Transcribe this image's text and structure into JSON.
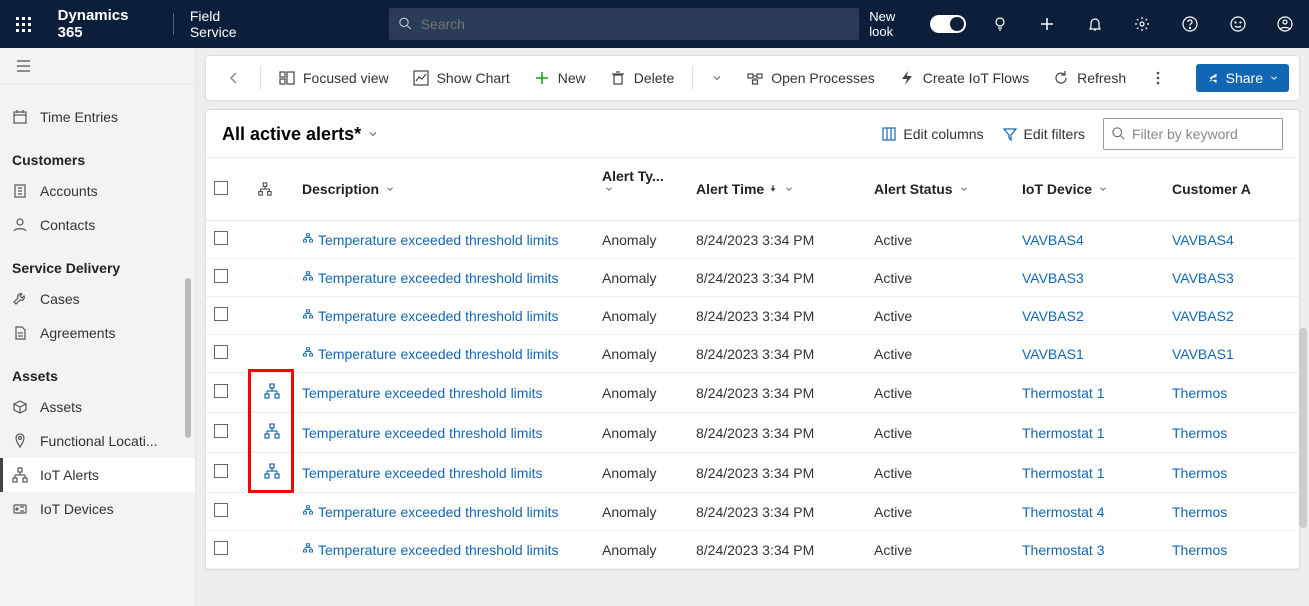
{
  "nav": {
    "brand": "Dynamics 365",
    "area": "Field Service",
    "search_placeholder": "Search",
    "newlook": "New look"
  },
  "sidebar": {
    "top_cut": "",
    "items_top": [
      {
        "label": "Time Entries",
        "icon": "calendar"
      }
    ],
    "groups": [
      {
        "title": "Customers",
        "items": [
          {
            "label": "Accounts",
            "icon": "building"
          },
          {
            "label": "Contacts",
            "icon": "person"
          }
        ]
      },
      {
        "title": "Service Delivery",
        "items": [
          {
            "label": "Cases",
            "icon": "wrench"
          },
          {
            "label": "Agreements",
            "icon": "doc"
          }
        ]
      },
      {
        "title": "Assets",
        "items": [
          {
            "label": "Assets",
            "icon": "cube"
          },
          {
            "label": "Functional Locati...",
            "icon": "pin"
          },
          {
            "label": "IoT Alerts",
            "icon": "hierarchy",
            "selected": true
          },
          {
            "label": "IoT Devices",
            "icon": "device"
          }
        ]
      }
    ]
  },
  "commands": {
    "focused": "Focused view",
    "chart": "Show Chart",
    "new": "New",
    "delete": "Delete",
    "open_proc": "Open Processes",
    "iot_flows": "Create IoT Flows",
    "refresh": "Refresh",
    "share": "Share"
  },
  "view": {
    "title": "All active alerts*",
    "edit_cols": "Edit columns",
    "edit_filters": "Edit filters",
    "filter_placeholder": "Filter by keyword"
  },
  "grid": {
    "headers": {
      "description": "Description",
      "alert_type": "Alert Ty...",
      "alert_time": "Alert Time",
      "alert_status": "Alert Status",
      "iot_device": "IoT Device",
      "customer": "Customer A"
    },
    "rows": [
      {
        "hier": false,
        "desc": "Temperature exceeded threshold limits",
        "type": "Anomaly",
        "time": "8/24/2023 3:34 PM",
        "status": "Active",
        "device": "VAVBAS4",
        "cust": "VAVBAS4"
      },
      {
        "hier": false,
        "desc": "Temperature exceeded threshold limits",
        "type": "Anomaly",
        "time": "8/24/2023 3:34 PM",
        "status": "Active",
        "device": "VAVBAS3",
        "cust": "VAVBAS3"
      },
      {
        "hier": false,
        "desc": "Temperature exceeded threshold limits",
        "type": "Anomaly",
        "time": "8/24/2023 3:34 PM",
        "status": "Active",
        "device": "VAVBAS2",
        "cust": "VAVBAS2"
      },
      {
        "hier": false,
        "desc": "Temperature exceeded threshold limits",
        "type": "Anomaly",
        "time": "8/24/2023 3:34 PM",
        "status": "Active",
        "device": "VAVBAS1",
        "cust": "VAVBAS1"
      },
      {
        "hier": true,
        "desc": "Temperature exceeded threshold limits",
        "type": "Anomaly",
        "time": "8/24/2023 3:34 PM",
        "status": "Active",
        "device": "Thermostat 1",
        "cust": "Thermos"
      },
      {
        "hier": true,
        "desc": "Temperature exceeded threshold limits",
        "type": "Anomaly",
        "time": "8/24/2023 3:34 PM",
        "status": "Active",
        "device": "Thermostat 1",
        "cust": "Thermos"
      },
      {
        "hier": true,
        "desc": "Temperature exceeded threshold limits",
        "type": "Anomaly",
        "time": "8/24/2023 3:34 PM",
        "status": "Active",
        "device": "Thermostat 1",
        "cust": "Thermos"
      },
      {
        "hier": false,
        "desc": "Temperature exceeded threshold limits",
        "type": "Anomaly",
        "time": "8/24/2023 3:34 PM",
        "status": "Active",
        "device": "Thermostat 4",
        "cust": "Thermos"
      },
      {
        "hier": false,
        "desc": "Temperature exceeded threshold limits",
        "type": "Anomaly",
        "time": "8/24/2023 3:34 PM",
        "status": "Active",
        "device": "Thermostat 3",
        "cust": "Thermos"
      }
    ]
  }
}
